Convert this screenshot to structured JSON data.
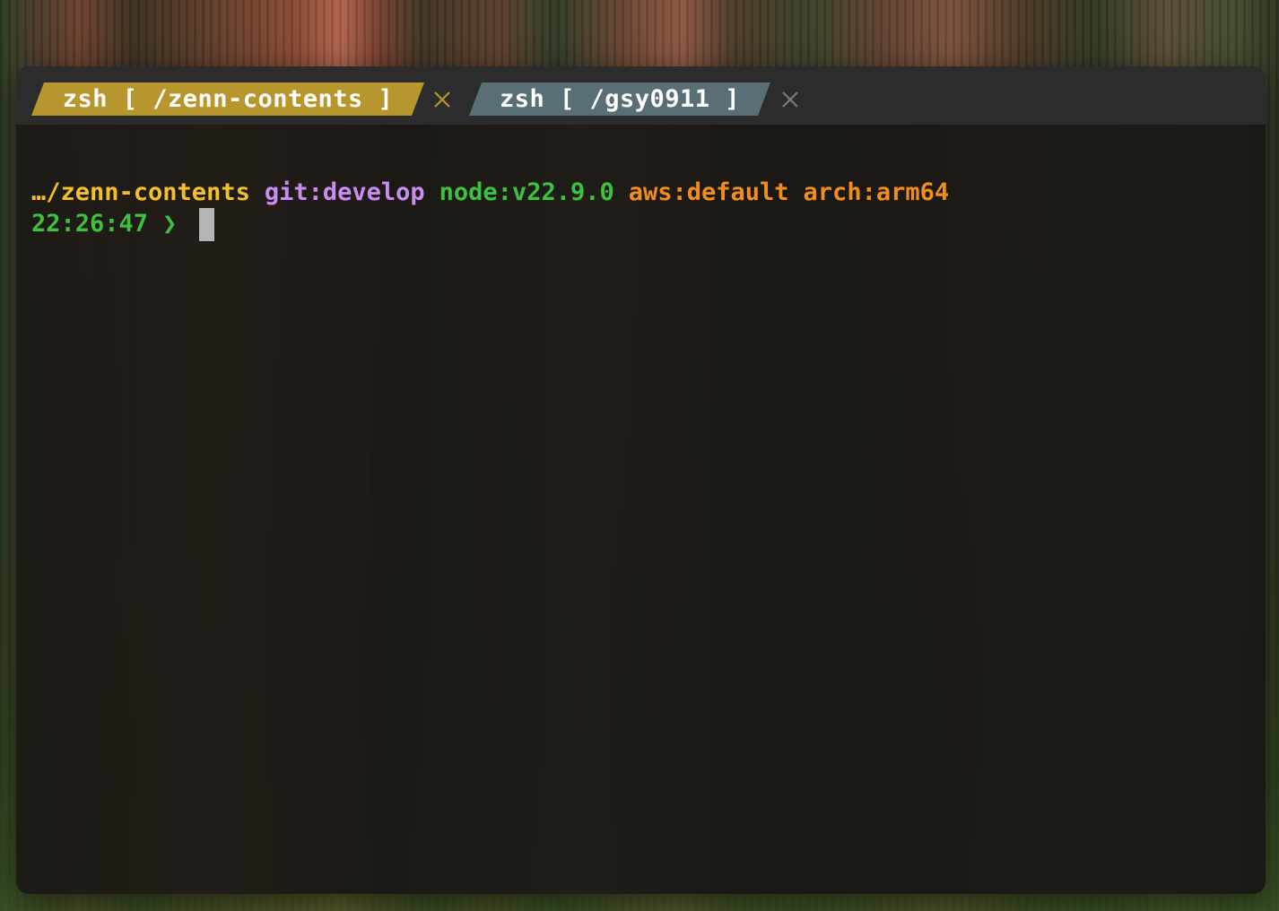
{
  "window": {
    "tabs": [
      {
        "label": "zsh [ /zenn-contents ]",
        "active": true,
        "color": "#b8962e"
      },
      {
        "label": "zsh [ /gsy0911 ]",
        "active": false,
        "color": "#5a6e76"
      }
    ],
    "close_icon": "close-icon"
  },
  "prompt": {
    "path": "…/zenn-contents",
    "git": "git:develop",
    "node": "node:v22.9.0",
    "aws": "aws:default",
    "arch": "arch:arm64",
    "time": "22:26:47",
    "symbol": "❯"
  },
  "colors": {
    "path": "#f2c02f",
    "git": "#c98df0",
    "node": "#3ec13e",
    "aws": "#f28c1e",
    "arch": "#f28c1e",
    "time": "#3ec13e",
    "symbol": "#3ec13e",
    "cursor": "#b5b5b5",
    "tab_bar": "#2c2c2c"
  }
}
